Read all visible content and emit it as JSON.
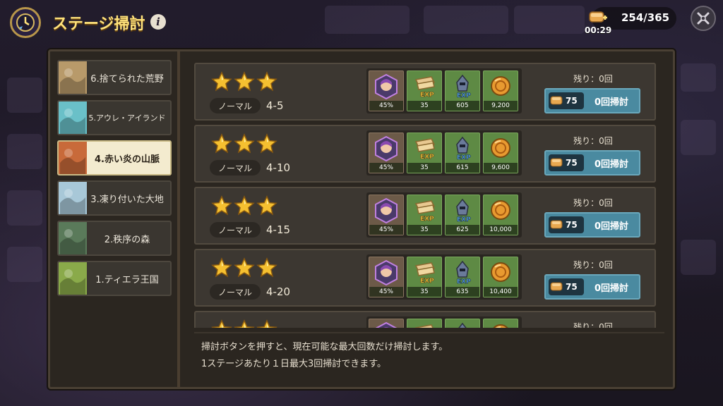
{
  "header": {
    "title": "ステージ掃討",
    "info_icon": "info-icon",
    "stamina": "254/365",
    "stamina_timer": "00:29",
    "close_icon": "close-icon"
  },
  "sidebar": {
    "items": [
      {
        "label": "6.捨てられた荒野",
        "thumb_color": "#b89a6a",
        "active": false
      },
      {
        "label": "5.アウレ・アイランド",
        "thumb_color": "#6ac0c8",
        "active": false
      },
      {
        "label": "4.赤い炎の山脈",
        "thumb_color": "#c86a3a",
        "active": true
      },
      {
        "label": "3.凍り付いた大地",
        "thumb_color": "#a8c8d8",
        "active": false
      },
      {
        "label": "2.秩序の森",
        "thumb_color": "#5a7a5a",
        "active": false
      },
      {
        "label": "1.ティエラ王国",
        "thumb_color": "#8aaa4a",
        "active": false
      }
    ]
  },
  "stages": [
    {
      "mode": "ノーマル",
      "stage": "4-5",
      "stars": 3,
      "rewards": [
        "45%",
        "35",
        "605",
        "9,200"
      ],
      "remaining": "残り：0回",
      "cost": "75",
      "sweep_label": "0回掃討"
    },
    {
      "mode": "ノーマル",
      "stage": "4-10",
      "stars": 3,
      "rewards": [
        "45%",
        "35",
        "615",
        "9,600"
      ],
      "remaining": "残り：0回",
      "cost": "75",
      "sweep_label": "0回掃討"
    },
    {
      "mode": "ノーマル",
      "stage": "4-15",
      "stars": 3,
      "rewards": [
        "45%",
        "35",
        "625",
        "10,000"
      ],
      "remaining": "残り：0回",
      "cost": "75",
      "sweep_label": "0回掃討"
    },
    {
      "mode": "ノーマル",
      "stage": "4-20",
      "stars": 3,
      "rewards": [
        "45%",
        "35",
        "635",
        "10,400"
      ],
      "remaining": "残り：0回",
      "cost": "75",
      "sweep_label": "0回掃討"
    },
    {
      "mode": "",
      "stage": "",
      "stars": 3,
      "rewards": [
        "",
        "",
        "",
        ""
      ],
      "remaining": "残り：0回",
      "cost": "",
      "sweep_label": ""
    }
  ],
  "reward_icons": [
    "hero-portrait-icon",
    "exp-scroll-icon",
    "exp-knight-icon",
    "gold-coin-icon"
  ],
  "notes": {
    "line1": "掃討ボタンを押すと、現在可能な最大回数だけ掃討します。",
    "line2": "1ステージあたり１日最大3回掃討できます。"
  },
  "colors": {
    "title": "#ffe27a",
    "panel": "#2b2620",
    "sweep_button": "#4a8aa0",
    "reward_bg": "#5e8a44",
    "star": "#f5c030"
  }
}
